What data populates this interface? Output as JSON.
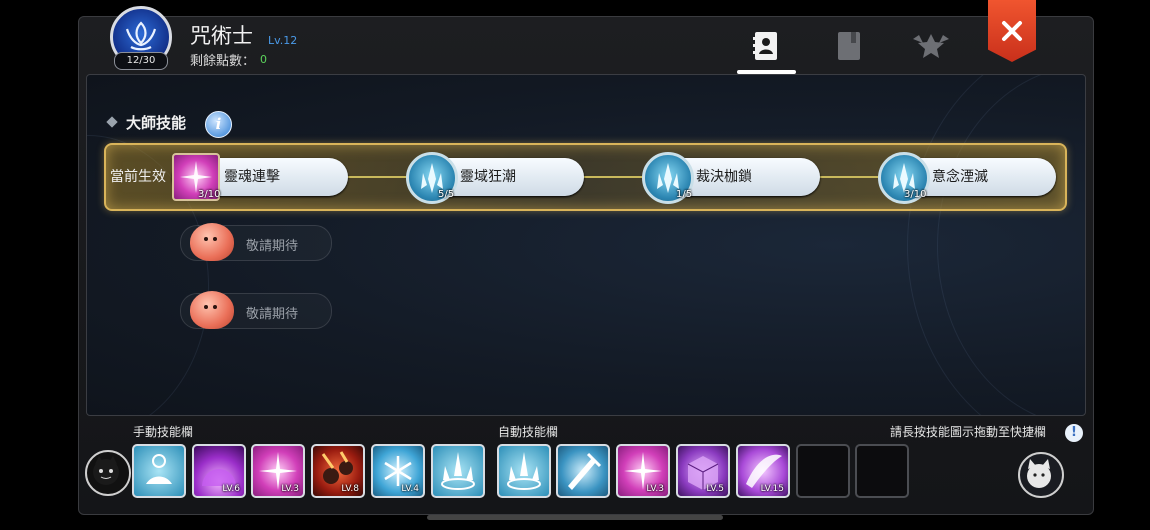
{
  "header": {
    "class_name": "咒術士",
    "class_level": "Lv.12",
    "emblem_progress": "12/30",
    "points_label": "剩餘點數：",
    "points_value": "0",
    "tabs": [
      {
        "icon": "skill-book-icon",
        "active": true
      },
      {
        "icon": "book-icon",
        "active": false
      },
      {
        "icon": "star-badge-icon",
        "active": false
      }
    ],
    "close_icon": "close-icon"
  },
  "master": {
    "title": "大師技能",
    "info_icon": "info-icon",
    "active_label": "當前生效",
    "skills": [
      {
        "name": "靈魂連擊",
        "level": "3/10"
      },
      {
        "name": "靈域狂潮",
        "level": "5/5"
      },
      {
        "name": "裁決枷鎖",
        "level": "1/5"
      },
      {
        "name": "意念湮滅",
        "level": "3/10"
      }
    ],
    "locked": [
      {
        "label": "敬請期待"
      },
      {
        "label": "敬請期待"
      }
    ]
  },
  "bottom": {
    "manual_label": "手動技能欄",
    "auto_label": "自動技能欄",
    "hint": "請長按技能圖示拖動至快捷欄",
    "manual_slots": [
      {
        "icon": "meditation-icon",
        "level": ""
      },
      {
        "icon": "purple-dome-icon",
        "level": "LV.6"
      },
      {
        "icon": "pink-burst-icon",
        "level": "LV.3"
      },
      {
        "icon": "meteor-icon",
        "level": "LV.8"
      },
      {
        "icon": "frost-icon",
        "level": "LV.4"
      },
      {
        "icon": "ice-field-icon",
        "level": ""
      }
    ],
    "auto_slots": [
      {
        "icon": "ice-field-icon",
        "level": ""
      },
      {
        "icon": "sword-strike-icon",
        "level": ""
      },
      {
        "icon": "pink-burst-icon",
        "level": "LV.3"
      },
      {
        "icon": "purple-cube-icon",
        "level": "LV.5"
      },
      {
        "icon": "violet-slash-icon",
        "level": "LV.15"
      },
      {
        "icon": "empty-slot",
        "level": ""
      },
      {
        "icon": "empty-slot",
        "level": ""
      }
    ]
  },
  "colors": {
    "accent_gold": "#d9b45a",
    "close_red": "#e0452a",
    "level_blue": "#4a9ae8",
    "points_green": "#5bd35b"
  }
}
